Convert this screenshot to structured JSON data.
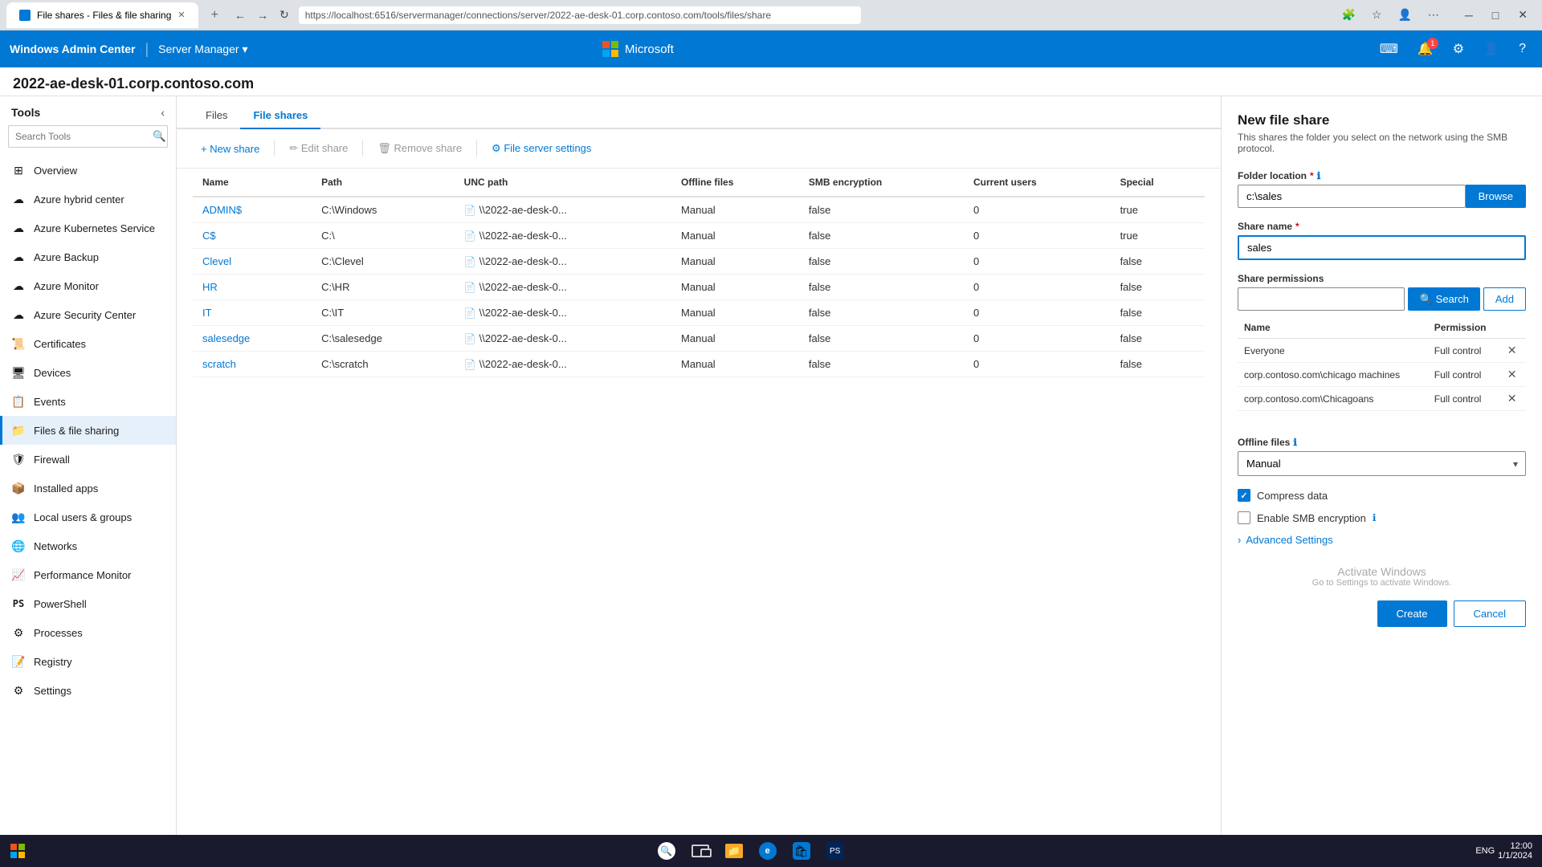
{
  "browser": {
    "tab_title": "File shares - Files & file sharing",
    "url": "https://localhost:6516/servermanager/connections/server/2022-ae-desk-01.corp.contoso.com/tools/files/share",
    "new_tab": "+",
    "back": "←",
    "forward": "→",
    "refresh": "↻"
  },
  "app_header": {
    "brand": "Windows Admin Center",
    "divider": "|",
    "section": "Server Manager",
    "ms_logo_text": "Microsoft",
    "terminal_icon": "⌨",
    "notifications_icon": "🔔",
    "notifications_count": "1",
    "settings_icon": "⚙",
    "user_icon": "👤",
    "help_icon": "?"
  },
  "page": {
    "title": "2022-ae-desk-01.corp.contoso.com",
    "tools_label": "Tools",
    "collapse_icon": "‹"
  },
  "sidebar": {
    "search_placeholder": "Search Tools",
    "items": [
      {
        "id": "overview",
        "label": "Overview",
        "icon": "⊞"
      },
      {
        "id": "azure-hybrid",
        "label": "Azure hybrid center",
        "icon": "☁"
      },
      {
        "id": "azure-kubernetes",
        "label": "Azure Kubernetes Service",
        "icon": "☁"
      },
      {
        "id": "azure-backup",
        "label": "Azure Backup",
        "icon": "☁"
      },
      {
        "id": "azure-monitor",
        "label": "Azure Monitor",
        "icon": "☁"
      },
      {
        "id": "azure-security",
        "label": "Azure Security Center",
        "icon": "☁"
      },
      {
        "id": "certificates",
        "label": "Certificates",
        "icon": "📜"
      },
      {
        "id": "devices",
        "label": "Devices",
        "icon": "🖥"
      },
      {
        "id": "events",
        "label": "Events",
        "icon": "📋"
      },
      {
        "id": "files-sharing",
        "label": "Files & file sharing",
        "icon": "📁",
        "active": true
      },
      {
        "id": "firewall",
        "label": "Firewall",
        "icon": "🛡"
      },
      {
        "id": "installed-apps",
        "label": "Installed apps",
        "icon": "📦"
      },
      {
        "id": "local-users",
        "label": "Local users & groups",
        "icon": "👥"
      },
      {
        "id": "networks",
        "label": "Networks",
        "icon": "🌐"
      },
      {
        "id": "performance",
        "label": "Performance Monitor",
        "icon": "📈"
      },
      {
        "id": "powershell",
        "label": "PowerShell",
        "icon": ">"
      },
      {
        "id": "processes",
        "label": "Processes",
        "icon": "⚙"
      },
      {
        "id": "registry",
        "label": "Registry",
        "icon": "📝"
      },
      {
        "id": "settings",
        "label": "Settings",
        "icon": "⚙"
      }
    ]
  },
  "tabs": [
    {
      "id": "files",
      "label": "Files"
    },
    {
      "id": "file-shares",
      "label": "File shares",
      "active": true
    }
  ],
  "toolbar": {
    "new_share": "+ New share",
    "edit_share": "✏ Edit share",
    "remove_share": "🗑 Remove share",
    "file_server_settings": "⚙ File server settings"
  },
  "table": {
    "columns": [
      "Name",
      "Path",
      "UNC path",
      "Offline files",
      "SMB encryption",
      "Current users",
      "Special"
    ],
    "rows": [
      {
        "name": "ADMIN$",
        "path": "C:\\Windows",
        "unc_path": "\\\\2022-ae-desk-0...",
        "offline_files": "Manual",
        "smb_encryption": "false",
        "current_users": "0",
        "special": "true"
      },
      {
        "name": "C$",
        "path": "C:\\",
        "unc_path": "\\\\2022-ae-desk-0...",
        "offline_files": "Manual",
        "smb_encryption": "false",
        "current_users": "0",
        "special": "true"
      },
      {
        "name": "Clevel",
        "path": "C:\\Clevel",
        "unc_path": "\\\\2022-ae-desk-0...",
        "offline_files": "Manual",
        "smb_encryption": "false",
        "current_users": "0",
        "special": "false"
      },
      {
        "name": "HR",
        "path": "C:\\HR",
        "unc_path": "\\\\2022-ae-desk-0...",
        "offline_files": "Manual",
        "smb_encryption": "false",
        "current_users": "0",
        "special": "false"
      },
      {
        "name": "IT",
        "path": "C:\\IT",
        "unc_path": "\\\\2022-ae-desk-0...",
        "offline_files": "Manual",
        "smb_encryption": "false",
        "current_users": "0",
        "special": "false"
      },
      {
        "name": "salesedge",
        "path": "C:\\salesedge",
        "unc_path": "\\\\2022-ae-desk-0...",
        "offline_files": "Manual",
        "smb_encryption": "false",
        "current_users": "0",
        "special": "false"
      },
      {
        "name": "scratch",
        "path": "C:\\scratch",
        "unc_path": "\\\\2022-ae-desk-0...",
        "offline_files": "Manual",
        "smb_encryption": "false",
        "current_users": "0",
        "special": "false"
      }
    ]
  },
  "panel": {
    "title": "New file share",
    "subtitle": "This shares the folder you select on the network using the SMB protocol.",
    "folder_location_label": "Folder location",
    "folder_location_value": "c:\\sales",
    "browse_label": "Browse",
    "share_name_label": "Share name",
    "share_name_value": "sales",
    "share_permissions_label": "Share permissions",
    "search_placeholder": "",
    "search_btn": "Search",
    "add_btn": "Add",
    "perm_name_col": "Name",
    "perm_permission_col": "Permission",
    "permissions": [
      {
        "name": "Everyone",
        "permission": "Full control"
      },
      {
        "name": "corp.contoso.com\\chicago machines",
        "permission": "Full control"
      },
      {
        "name": "corp.contoso.com\\Chicagoans",
        "permission": "Full control"
      }
    ],
    "offline_files_label": "Offline files",
    "offline_files_value": "Manual",
    "compress_data_label": "Compress data",
    "compress_data_checked": true,
    "enable_smb_label": "Enable SMB encryption",
    "enable_smb_checked": false,
    "advanced_settings_label": "Advanced Settings",
    "activate_title": "Activate Windows",
    "activate_sub": "Go to Settings to activate Windows.",
    "create_btn": "Create",
    "cancel_btn": "Cancel"
  },
  "taskbar": {
    "time": "12:00",
    "date": "1/1/2024"
  }
}
